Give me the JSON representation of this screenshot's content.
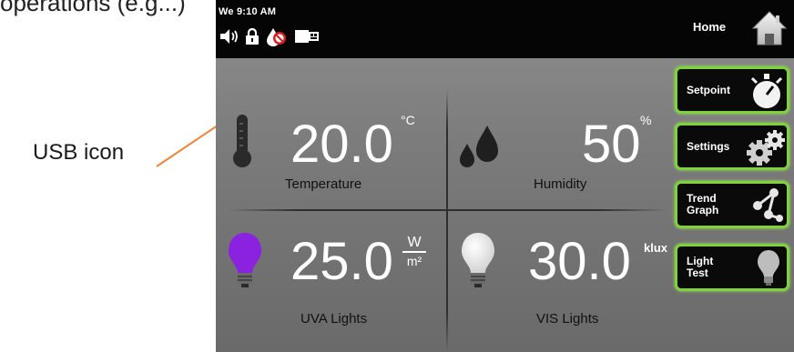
{
  "header_fragment": "operations (e.g...)",
  "annotation": {
    "label": "USB icon",
    "arrow_color": "#f0843a"
  },
  "statusbar": {
    "time": "We 9:10 AM",
    "icons": [
      "speaker-icon",
      "lock-icon",
      "no-water-icon",
      "usb-icon"
    ],
    "home_label": "Home"
  },
  "readings": {
    "temperature": {
      "value": "20.0",
      "unit": "°C",
      "label": "Temperature"
    },
    "humidity": {
      "value": "50",
      "unit": "%",
      "label": "Humidity"
    },
    "uva": {
      "value": "25.0",
      "unit_num": "W",
      "unit_den": "m²",
      "label": "UVA Lights",
      "bulb_color": "#8b22e0"
    },
    "vis": {
      "value": "30.0",
      "unit": "klux",
      "label": "VIS Lights"
    }
  },
  "sidebar": {
    "setpoint": "Setpoint",
    "settings": "Settings",
    "trend_graph": "Trend\nGraph",
    "light_test": "Light\nTest"
  },
  "colors": {
    "button_border": "#7ed23a",
    "screen_bg": "#7a7a7a"
  }
}
